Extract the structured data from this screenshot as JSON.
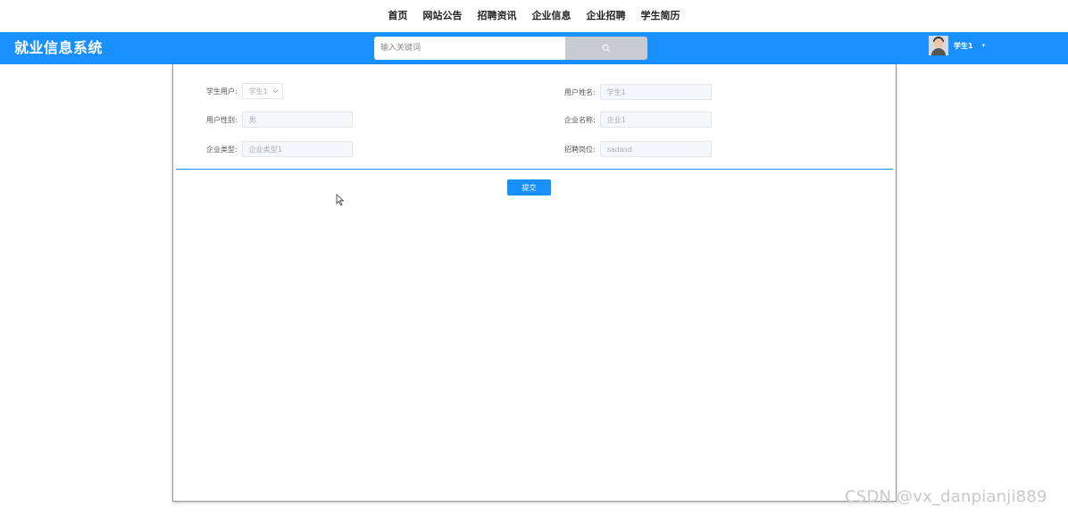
{
  "topnav": {
    "items": [
      "首页",
      "网站公告",
      "招聘资讯",
      "企业信息",
      "企业招聘",
      "学生简历"
    ]
  },
  "header": {
    "title": "就业信息系统",
    "search_placeholder": "输入关键词",
    "search_icon": "search-icon",
    "username": "学生1",
    "caret": "▾"
  },
  "form": {
    "student_user": {
      "label": "学生用户:",
      "value": "学生1"
    },
    "user_name": {
      "label": "用户姓名:",
      "value": "学生1"
    },
    "user_gender": {
      "label": "用户性别:",
      "value": "男"
    },
    "company_name": {
      "label": "企业名称:",
      "value": "企业1"
    },
    "company_type": {
      "label": "企业类型:",
      "value": "企业类型1"
    },
    "job_position": {
      "label": "招聘岗位:",
      "value": "sadasd"
    },
    "submit_label": "提交"
  },
  "watermark": "CSDN @vx_danpianji889",
  "colors": {
    "accent": "#1890ff",
    "search_button": "#c8cbd1",
    "field_bg": "#f5f7fa"
  }
}
